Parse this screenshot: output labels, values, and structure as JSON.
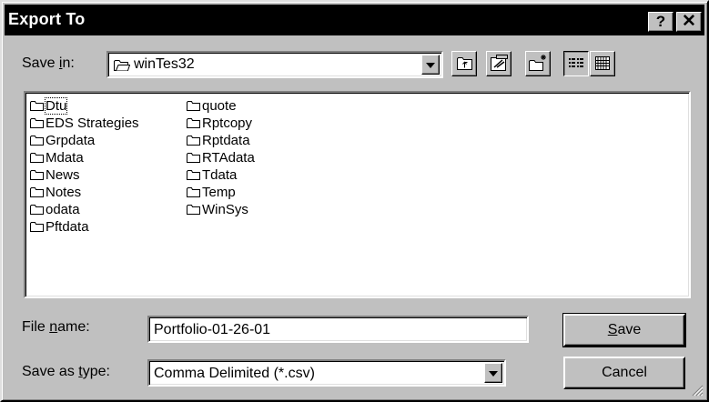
{
  "dialog": {
    "title": "Export To",
    "help_label": "?",
    "close_label": "✕"
  },
  "save_in": {
    "label_prefix": "Save ",
    "label_accel": "i",
    "label_suffix": "n:",
    "value": "winTes32"
  },
  "files": {
    "column1": [
      "Dtu",
      "EDS Strategies",
      "Grpdata",
      "Mdata",
      "News",
      "Notes",
      "odata",
      "Pftdata"
    ],
    "column2": [
      "quote",
      "Rptcopy",
      "Rptdata",
      "RTAdata",
      "Tdata",
      "Temp",
      "WinSys"
    ]
  },
  "file_name": {
    "label_prefix": "File ",
    "label_accel": "n",
    "label_suffix": "ame:",
    "value": "Portfolio-01-26-01"
  },
  "save_type": {
    "label_prefix": "Save as ",
    "label_accel": "t",
    "label_suffix": "ype:",
    "value": "Comma Delimited (*.csv)"
  },
  "buttons": {
    "save_accel": "S",
    "save_rest": "ave",
    "cancel": "Cancel"
  }
}
